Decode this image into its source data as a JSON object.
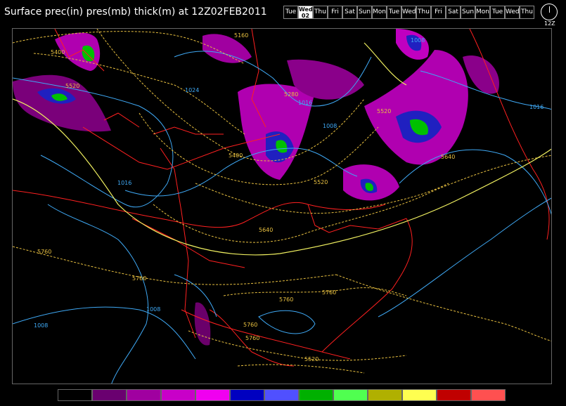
{
  "header": {
    "title": "Surface prec(in) pres(mb) thick(m) at 12Z02FEB2011"
  },
  "day_selector": {
    "days": [
      {
        "label": "Tue",
        "sub": ""
      },
      {
        "label": "Wed",
        "sub": "02",
        "selected": true
      },
      {
        "label": "Thu",
        "sub": ""
      },
      {
        "label": "Fri",
        "sub": ""
      },
      {
        "label": "Sat",
        "sub": ""
      },
      {
        "label": "Sun",
        "sub": ""
      },
      {
        "label": "Mon",
        "sub": ""
      },
      {
        "label": "Tue",
        "sub": ""
      },
      {
        "label": "Wed",
        "sub": ""
      },
      {
        "label": "Thu",
        "sub": ""
      },
      {
        "label": "Fri",
        "sub": ""
      },
      {
        "label": "Sat",
        "sub": ""
      },
      {
        "label": "Sun",
        "sub": ""
      },
      {
        "label": "Mon",
        "sub": ""
      },
      {
        "label": "Tue",
        "sub": ""
      },
      {
        "label": "Wed",
        "sub": ""
      },
      {
        "label": "Thu",
        "sub": ""
      }
    ],
    "clock_label": "12Z"
  },
  "map": {
    "pressure_labels": [
      "1024",
      "1016",
      "1016",
      "1008",
      "1008",
      "1016",
      "1008",
      "1008"
    ],
    "thickness_labels": [
      "5160",
      "5400",
      "5520",
      "5280",
      "5520",
      "5400",
      "5520",
      "5640",
      "5640",
      "5760",
      "5760",
      "5760",
      "5760",
      "5760",
      "5760",
      "5520"
    ],
    "colors": {
      "pressure_isobar": "#3fa9f5",
      "thickness_contour": "#e8c040",
      "borders": "#ff2020",
      "precip_light": "#6a006a",
      "precip_mid": "#d000d0",
      "precip_blue": "#2020c0",
      "precip_green": "#00c000",
      "precip_yellow": "#c0c000"
    }
  },
  "legend": {
    "colors": [
      "#000000",
      "#6a0070",
      "#a000a0",
      "#c800c8",
      "#f000f0",
      "#0000c0",
      "#5050ff",
      "#00b000",
      "#50ff50",
      "#b0b000",
      "#ffff50",
      "#c00000",
      "#ff5050"
    ]
  }
}
